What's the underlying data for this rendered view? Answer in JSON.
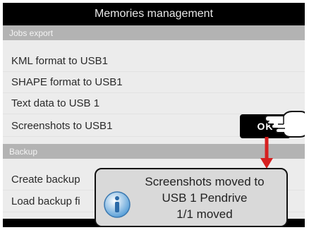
{
  "header": {
    "title": "Memories management"
  },
  "sections": {
    "jobs_export": {
      "title": "Jobs export",
      "items": [
        {
          "label": "KML format to USB1"
        },
        {
          "label": "SHAPE format to USB1"
        },
        {
          "label": "Text data to USB 1"
        },
        {
          "label": "Screenshots to USB1"
        }
      ]
    },
    "backup": {
      "title": "Backup",
      "items": [
        {
          "label": "Create backup"
        },
        {
          "label": "Load backup fi"
        }
      ]
    }
  },
  "ok_button": {
    "label": "OK"
  },
  "dialog": {
    "line1": "Screenshots moved to",
    "line2": "USB 1 Pendrive",
    "line3": "1/1 moved"
  },
  "icons": {
    "info": "info-icon",
    "hand": "pointing-hand-icon",
    "arrow": "down-arrow-icon"
  },
  "colors": {
    "titlebar": "#000000",
    "section_header": "#b3b3b3",
    "list_background": "#ececec",
    "arrow": "#d62020",
    "dialog_background": "#d9d9d9"
  }
}
